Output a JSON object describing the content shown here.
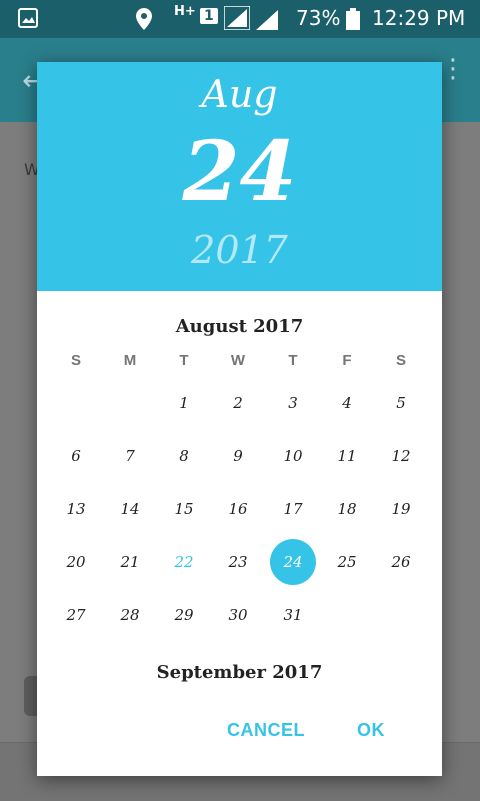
{
  "status_bar": {
    "network": "H+",
    "sim": "1",
    "battery": "73%",
    "time": "12:29 PM"
  },
  "background_app": {
    "text_fragment": "W"
  },
  "date_picker": {
    "header": {
      "month": "Aug",
      "day": "24",
      "year": "2017"
    },
    "current_month_title": "August 2017",
    "next_month_title": "September 2017",
    "weekdays": [
      "S",
      "M",
      "T",
      "W",
      "T",
      "F",
      "S"
    ],
    "first_weekday_index": 2,
    "days": [
      "1",
      "2",
      "3",
      "4",
      "5",
      "6",
      "7",
      "8",
      "9",
      "10",
      "11",
      "12",
      "13",
      "14",
      "15",
      "16",
      "17",
      "18",
      "19",
      "20",
      "21",
      "22",
      "23",
      "24",
      "25",
      "26",
      "27",
      "28",
      "29",
      "30",
      "31"
    ],
    "today": "22",
    "selected": "24",
    "accent_color": "#35c3e8",
    "cancel_label": "CANCEL",
    "ok_label": "OK"
  }
}
